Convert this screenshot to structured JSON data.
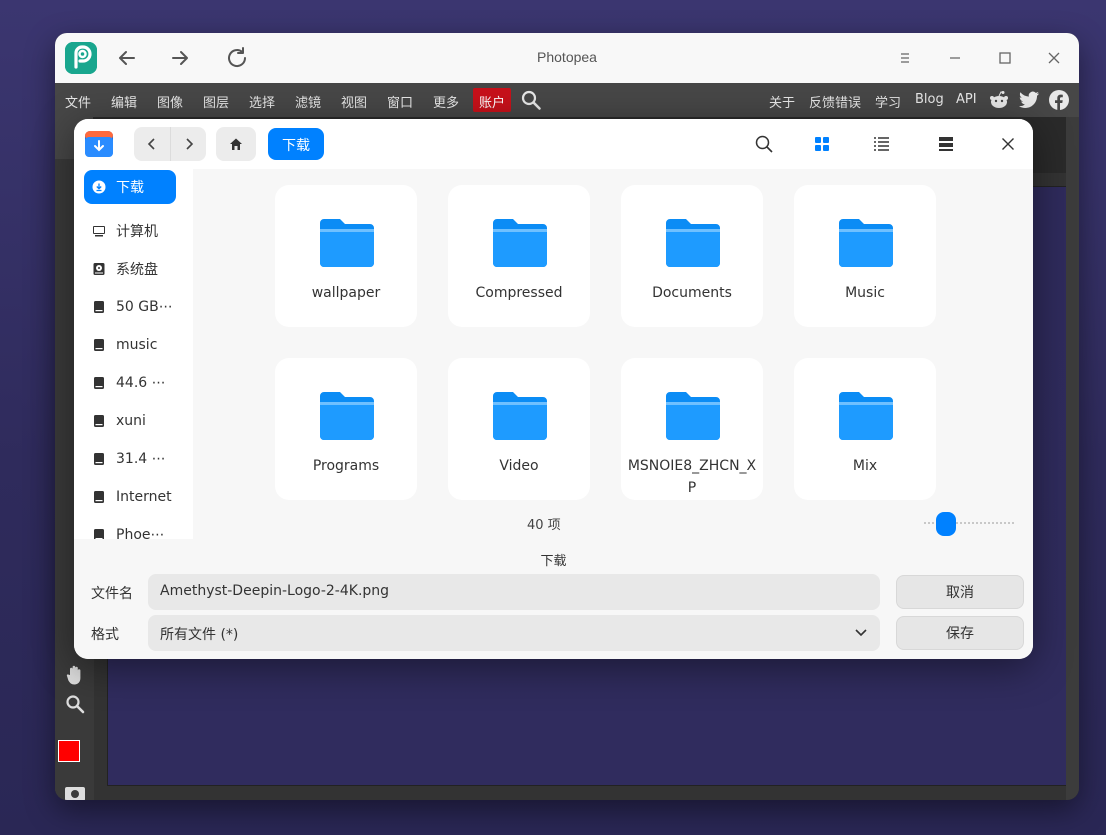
{
  "window": {
    "title": "Photopea"
  },
  "menubar": {
    "left_items": [
      "文件",
      "编辑",
      "图像",
      "图层",
      "选择",
      "滤镜",
      "视图",
      "窗口",
      "更多"
    ],
    "account": "账户",
    "right_items": [
      "关于",
      "反馈错误",
      "学习",
      "Blog",
      "API"
    ],
    "social_icons": [
      "reddit-icon",
      "twitter-icon",
      "facebook-icon"
    ]
  },
  "dialog": {
    "breadcrumb": "下载",
    "sidebar": [
      {
        "label": "下载",
        "icon": "download-icon",
        "active": true
      },
      {
        "label": "计算机",
        "icon": "computer-icon"
      },
      {
        "label": "系统盘",
        "icon": "system-disk-icon"
      },
      {
        "label": "50 GB⋯",
        "icon": "disk-icon"
      },
      {
        "label": "music",
        "icon": "disk-icon"
      },
      {
        "label": "44.6 ⋯",
        "icon": "disk-icon"
      },
      {
        "label": "xuni",
        "icon": "disk-icon"
      },
      {
        "label": "31.4 ⋯",
        "icon": "disk-icon"
      },
      {
        "label": "Internet",
        "icon": "disk-icon"
      },
      {
        "label": "Phoe⋯",
        "icon": "disk-icon"
      }
    ],
    "folders": [
      "wallpaper",
      "Compressed",
      "Documents",
      "Music",
      "Programs",
      "Video",
      "MSNOIE8_ZHCN_XP",
      "Mix"
    ],
    "item_count": "40 项",
    "current_dir": "下载",
    "filename_label": "文件名",
    "filename_value": "Amethyst-Deepin-Logo-2-4K.png",
    "format_label": "格式",
    "format_value": "所有文件 (*)",
    "cancel_label": "取消",
    "save_label": "保存"
  },
  "colors": {
    "accent": "#0081ff",
    "account_red": "#c8111a",
    "foreground_color": "#ff0000",
    "background_color": "#000000"
  }
}
